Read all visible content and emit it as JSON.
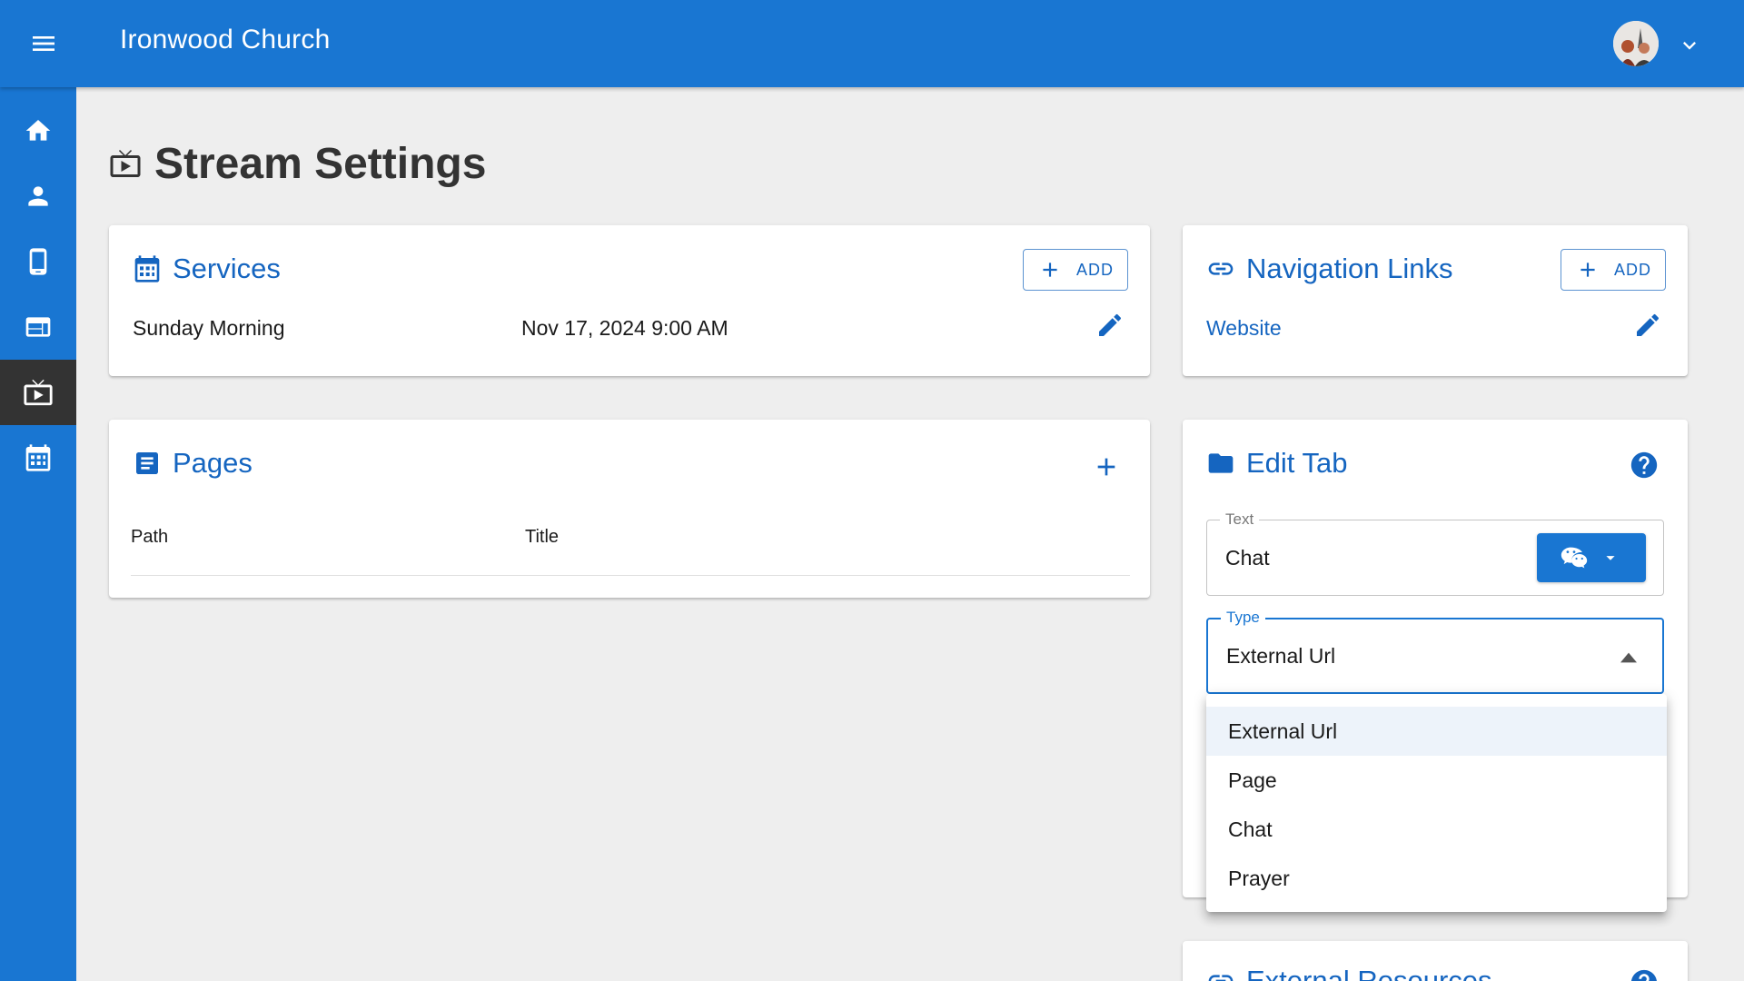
{
  "app": {
    "title": "Ironwood Church"
  },
  "page": {
    "title": "Stream Settings"
  },
  "sidebar": {
    "items": [
      {
        "name": "home",
        "icon": "home-icon",
        "active": false
      },
      {
        "name": "people",
        "icon": "person-icon",
        "active": false
      },
      {
        "name": "mobile",
        "icon": "phone-icon",
        "active": false
      },
      {
        "name": "website",
        "icon": "web-icon",
        "active": false
      },
      {
        "name": "stream",
        "icon": "live-tv-icon",
        "active": true
      },
      {
        "name": "calendar",
        "icon": "calendar-icon",
        "active": false
      }
    ]
  },
  "services": {
    "title": "Services",
    "add_label": "ADD",
    "rows": [
      {
        "name": "Sunday Morning",
        "time": "Nov 17, 2024 9:00 AM"
      }
    ]
  },
  "navigation_links": {
    "title": "Navigation Links",
    "add_label": "ADD",
    "links": [
      {
        "text": "Website"
      }
    ]
  },
  "pages": {
    "title": "Pages",
    "columns": [
      "Path",
      "Title"
    ]
  },
  "edit_tab": {
    "title": "Edit Tab",
    "text_label": "Text",
    "text_value": "Chat",
    "type_label": "Type",
    "type_value": "External Url",
    "type_options": [
      "External Url",
      "Page",
      "Chat",
      "Prayer"
    ],
    "selected_option": "External Url"
  },
  "external_resources": {
    "title": "External Resources"
  },
  "colors": {
    "primary": "#1976d2",
    "title_blue": "#1565c0",
    "active_nav": "#333333",
    "background": "#eeeeee"
  }
}
